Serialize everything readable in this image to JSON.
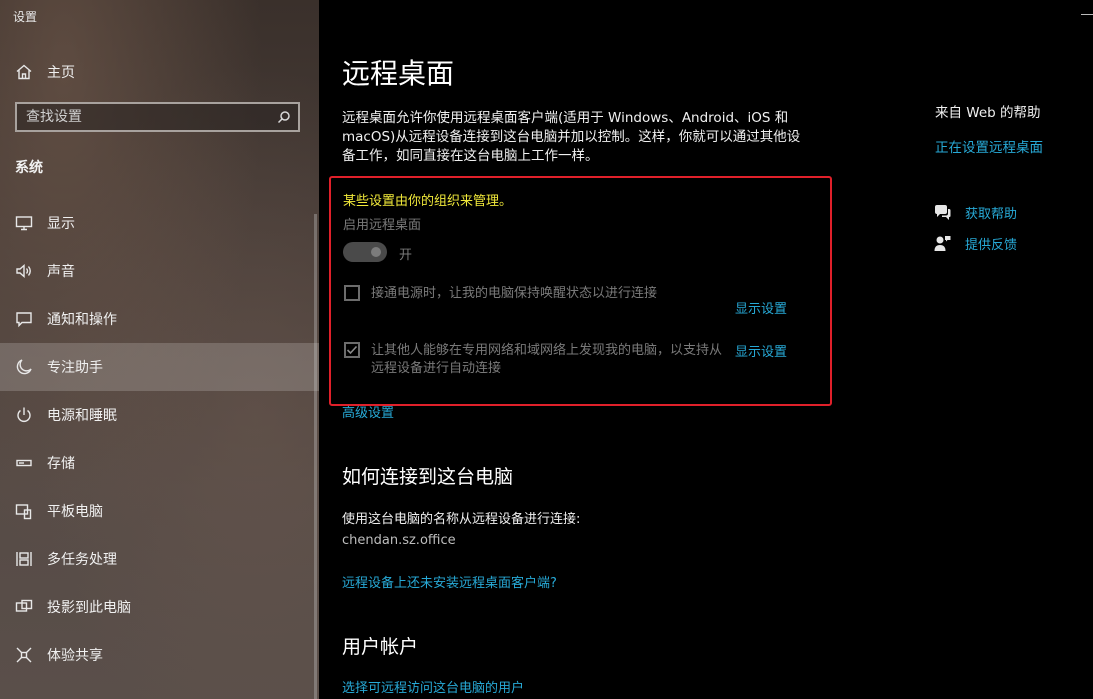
{
  "app": {
    "title": "设置"
  },
  "sidebar": {
    "home_label": "主页",
    "search_placeholder": "查找设置",
    "section_heading": "系统",
    "items": [
      {
        "label": "显示",
        "icon": "monitor-icon"
      },
      {
        "label": "声音",
        "icon": "speaker-icon"
      },
      {
        "label": "通知和操作",
        "icon": "message-icon"
      },
      {
        "label": "专注助手",
        "icon": "moon-icon",
        "selected": true
      },
      {
        "label": "电源和睡眠",
        "icon": "power-icon"
      },
      {
        "label": "存储",
        "icon": "storage-icon"
      },
      {
        "label": "平板电脑",
        "icon": "tablet-icon"
      },
      {
        "label": "多任务处理",
        "icon": "multitask-icon"
      },
      {
        "label": "投影到此电脑",
        "icon": "project-icon"
      },
      {
        "label": "体验共享",
        "icon": "share-icon"
      }
    ]
  },
  "main": {
    "title": "远程桌面",
    "description": "远程桌面允许你使用远程桌面客户端(适用于 Windows、Android、iOS 和 macOS)从远程设备连接到这台电脑并加以控制。这样，你就可以通过其他设备工作，如同直接在这台电脑上工作一样。",
    "managed_notice": "某些设置由你的组织来管理。",
    "enable_label": "启用远程桌面",
    "toggle_state": "开",
    "option1_text": "接通电源时，让我的电脑保持唤醒状态以进行连接",
    "option1_checked": false,
    "option2_text": "让其他人能够在专用网络和域网络上发现我的电脑，以支持从远程设备进行自动连接",
    "option2_checked": true,
    "show_settings_label": "显示设置",
    "advanced_link": "高级设置",
    "connect_heading": "如何连接到这台电脑",
    "connect_desc": "使用这台电脑的名称从远程设备进行连接:",
    "pc_name": "chendan.sz.office",
    "client_link": "远程设备上还未安装远程桌面客户端?",
    "accounts_heading": "用户帐户",
    "users_link": "选择可远程访问这台电脑的用户"
  },
  "help": {
    "title": "来自 Web 的帮助",
    "link1": "正在设置远程桌面",
    "get_help": "获取帮助",
    "feedback": "提供反馈"
  },
  "colors": {
    "accent": "#27a9d6",
    "warning": "#f2ea3a",
    "highlight_border": "#e0202a"
  }
}
